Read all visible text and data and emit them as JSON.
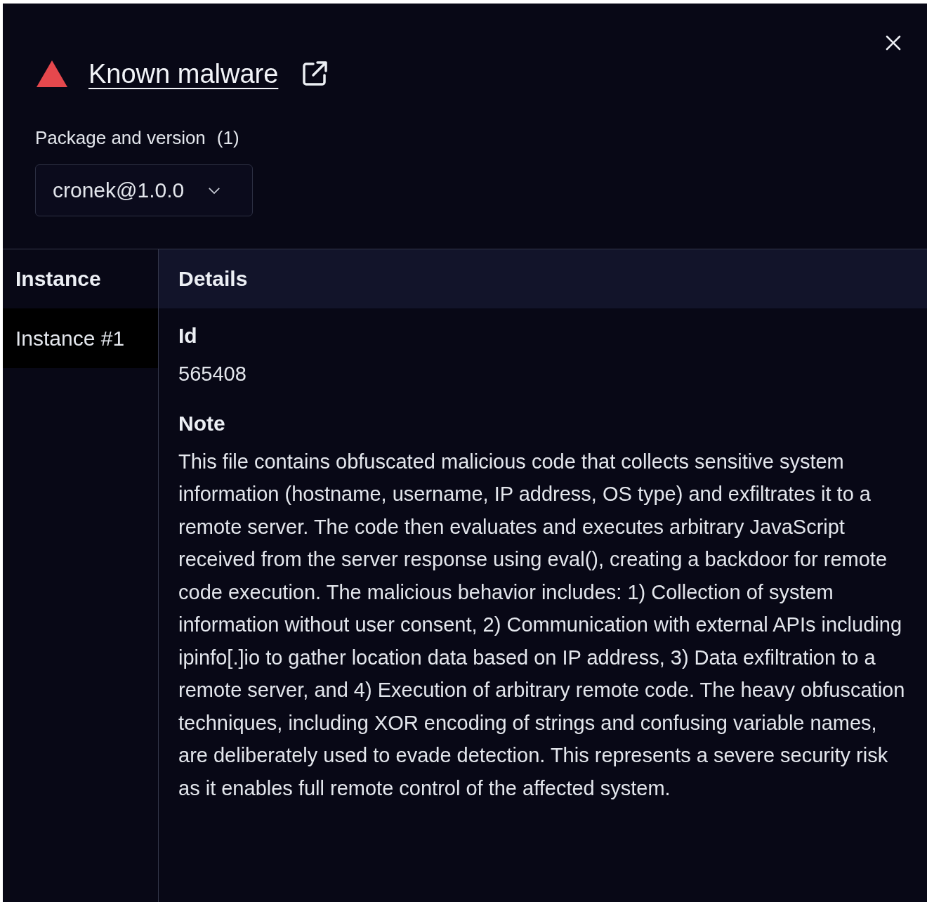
{
  "header": {
    "title": "Known malware",
    "package_label": "Package and version",
    "package_count": "(1)",
    "package_value": "cronek@1.0.0"
  },
  "table": {
    "columns": [
      "Instance",
      "Details"
    ],
    "instances": [
      {
        "label": "Instance #1",
        "selected": true
      }
    ],
    "details": [
      {
        "label": "Id",
        "value": "565408"
      },
      {
        "label": "Note",
        "value": "This file contains obfuscated malicious code that collects sensitive system information (hostname, username, IP address, OS type) and exfiltrates it to a remote server. The code then evaluates and executes arbitrary JavaScript received from the server response using eval(), creating a backdoor for remote code execution. The malicious behavior includes: 1) Collection of system information without user consent, 2) Communication with external APIs including ipinfo[.]io to gather location data based on IP address, 3) Data exfiltration to a remote server, and 4) Execution of arbitrary remote code. The heavy obfuscation techniques, including XOR encoding of strings and confusing variable names, are deliberately used to evade detection. This represents a severe security risk as it enables full remote control of the affected system."
      }
    ]
  }
}
